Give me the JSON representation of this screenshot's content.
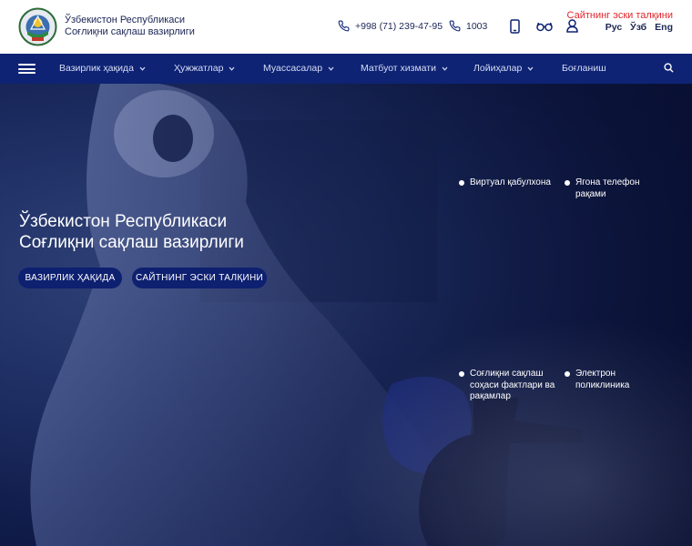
{
  "header": {
    "org_line1": "Ўзбекистон Республикаси",
    "org_line2": "Соғлиқни сақлаш вазирлиги",
    "phone": "+998 (71) 239-47-95",
    "short_phone": "1003",
    "old_site_link": "Сайтнинг эски талқини",
    "languages": [
      "Рус",
      "Ўзб",
      "Eng"
    ],
    "icons": [
      "phone-icon",
      "mobile-icon",
      "glasses-icon",
      "user-icon"
    ]
  },
  "nav": {
    "items": [
      {
        "label": "Вазирлик ҳақида",
        "dropdown": true
      },
      {
        "label": "Ҳужжатлар",
        "dropdown": true
      },
      {
        "label": "Муассасалар",
        "dropdown": true
      },
      {
        "label": "Матбуот хизмати",
        "dropdown": true
      },
      {
        "label": "Лойиҳалар",
        "dropdown": true
      },
      {
        "label": "Боғланиш",
        "dropdown": false
      }
    ]
  },
  "hero": {
    "title_line1": "Ўзбекистон Республикаси",
    "title_line2": "Соғлиқни сақлаш вазирлиги",
    "button_about": "ВАЗИРЛИК ҲАҚИДА",
    "button_old_site": "САЙТНИНГ ЭСКИ ТАЛҚИНИ",
    "quick_links": [
      "Виртуал қабулхона",
      "Ягона телефон рақами",
      "Соғлиқни сақлаш соҳаси фактлари ва рақамлар",
      "Электрон поликлиника"
    ]
  },
  "colors": {
    "nav_bg": "#0e2374",
    "header_bg": "#ffffff",
    "text_dark": "#1b2554",
    "accent_red": "#e0262c",
    "button_bg": "#0e2070"
  }
}
